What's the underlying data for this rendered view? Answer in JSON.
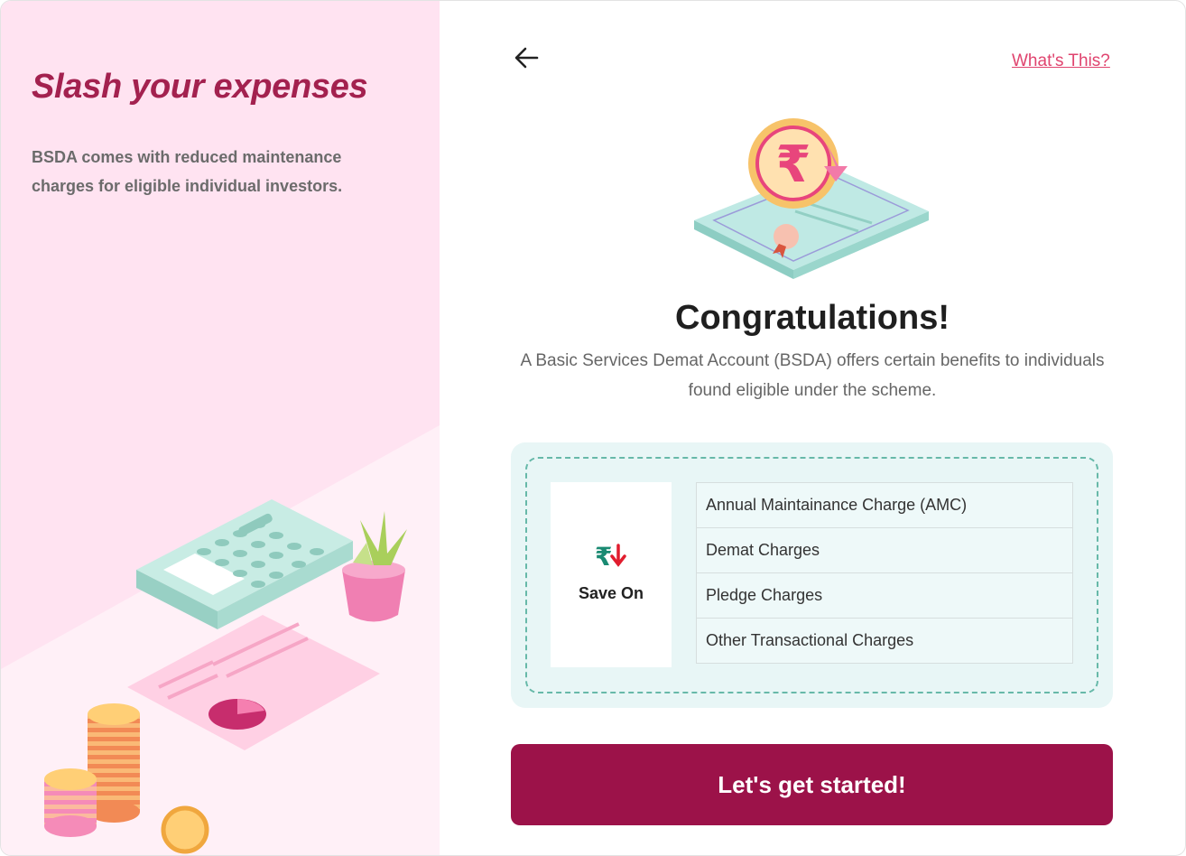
{
  "left": {
    "heading": "Slash your expenses",
    "description": "BSDA comes with reduced maintenance charges for eligible individual investors."
  },
  "header": {
    "back_icon": "arrow-left-icon",
    "whats_this": "What's This?"
  },
  "main": {
    "title": "Congratulations!",
    "subtitle": "A Basic Services Demat Account (BSDA) offers certain benefits to individuals found eligible under the scheme.",
    "save_on_label": "Save On",
    "save_on_icon": "rupee-down-icon",
    "benefits": [
      "Annual Maintainance Charge (AMC)",
      "Demat Charges",
      "Pledge Charges",
      "Other Transactional Charges"
    ],
    "cta_label": "Let's get started!"
  },
  "colors": {
    "accent": "#9c1249",
    "heading": "#a3214f",
    "link": "#e0446f",
    "panel": "#e8f6f6",
    "dash": "#67b9a9",
    "left_bg": "#ffe3f1"
  }
}
